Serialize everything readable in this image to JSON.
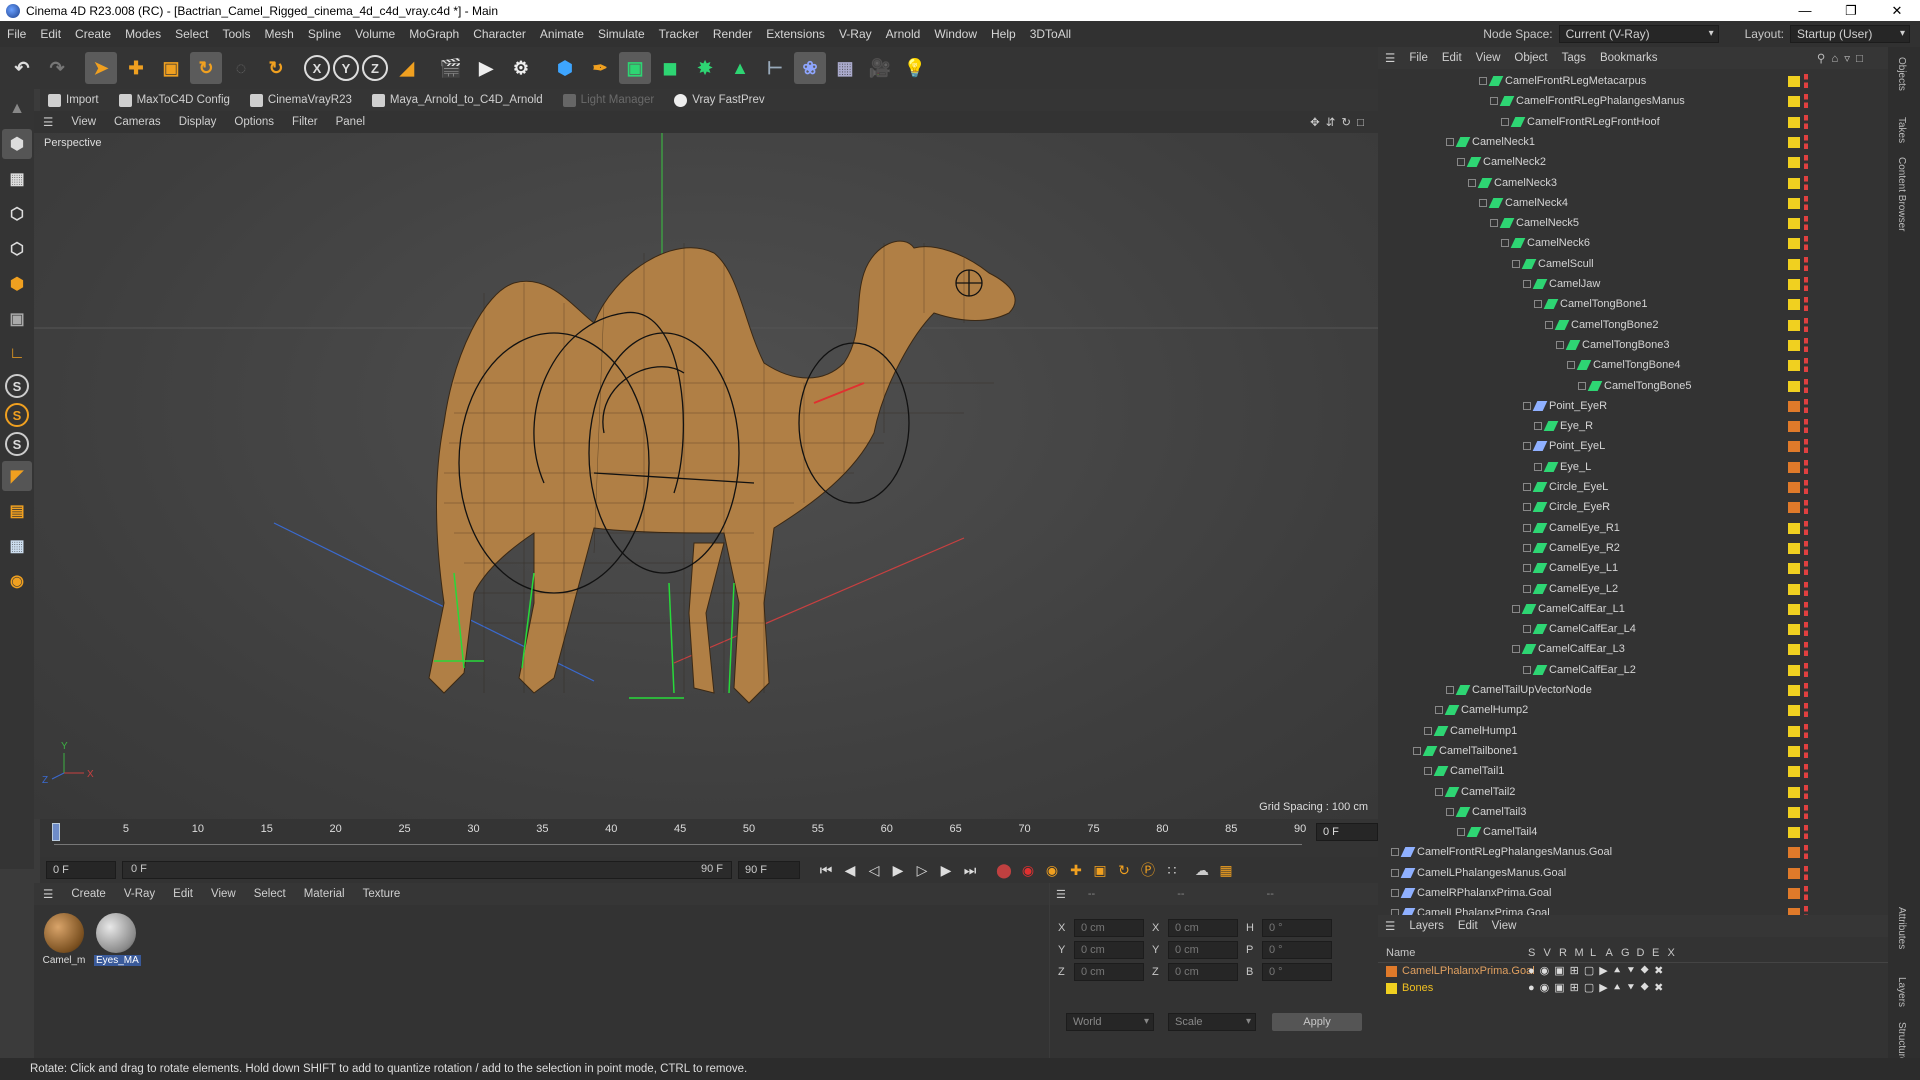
{
  "window": {
    "title": "Cinema 4D R23.008 (RC) - [Bactrian_Camel_Rigged_cinema_4d_c4d_vray.c4d *] - Main"
  },
  "menu": {
    "items": [
      "File",
      "Edit",
      "Create",
      "Modes",
      "Select",
      "Tools",
      "Mesh",
      "Spline",
      "Volume",
      "MoGraph",
      "Character",
      "Animate",
      "Simulate",
      "Tracker",
      "Render",
      "Extensions",
      "V-Ray",
      "Arnold",
      "Window",
      "Help",
      "3DToAll"
    ],
    "node_space_label": "Node Space:",
    "node_space_value": "Current (V-Ray)",
    "layout_label": "Layout:",
    "layout_value": "Startup (User)"
  },
  "plugins": [
    "Import",
    "MaxToC4D Config",
    "CinemaVrayR23",
    "Maya_Arnold_to_C4D_Arnold",
    "Light Manager",
    "Vray FastPrev"
  ],
  "viewport": {
    "menu": [
      "View",
      "Cameras",
      "Display",
      "Options",
      "Filter",
      "Panel"
    ],
    "label": "Perspective",
    "grid_spacing": "Grid Spacing : 100 cm"
  },
  "timeline": {
    "ticks": [
      "0",
      "5",
      "10",
      "15",
      "20",
      "25",
      "30",
      "35",
      "40",
      "45",
      "50",
      "55",
      "60",
      "65",
      "70",
      "75",
      "80",
      "85",
      "90"
    ],
    "current_frame": "0 F"
  },
  "transport": {
    "start": "0 F",
    "slider_start": "0 F",
    "slider_end": "90 F",
    "end": "90 F"
  },
  "material_menu": [
    "Create",
    "V-Ray",
    "Edit",
    "View",
    "Select",
    "Material",
    "Texture"
  ],
  "materials": [
    {
      "name": "Camel_m"
    },
    {
      "name": "Eyes_MA"
    }
  ],
  "coords": {
    "header": "--",
    "rows": [
      {
        "a": "X",
        "av": "0 cm",
        "b": "X",
        "bv": "0 cm",
        "c": "H",
        "cv": "0 °"
      },
      {
        "a": "Y",
        "av": "0 cm",
        "b": "Y",
        "bv": "0 cm",
        "c": "P",
        "cv": "0 °"
      },
      {
        "a": "Z",
        "av": "0 cm",
        "b": "Z",
        "bv": "0 cm",
        "c": "B",
        "cv": "0 °"
      }
    ],
    "mode1": "World",
    "mode2": "Scale",
    "apply": "Apply"
  },
  "objects": {
    "menu": [
      "File",
      "Edit",
      "View",
      "Object",
      "Tags",
      "Bookmarks"
    ],
    "rows": [
      {
        "name": "CamelFrontRLegMetacarpus",
        "d": 9
      },
      {
        "name": "CamelFrontRLegPhalangesManus",
        "d": 10
      },
      {
        "name": "CamelFrontRLegFrontHoof",
        "d": 11
      },
      {
        "name": "CamelNeck1",
        "d": 6
      },
      {
        "name": "CamelNeck2",
        "d": 7
      },
      {
        "name": "CamelNeck3",
        "d": 8
      },
      {
        "name": "CamelNeck4",
        "d": 9
      },
      {
        "name": "CamelNeck5",
        "d": 10
      },
      {
        "name": "CamelNeck6",
        "d": 11
      },
      {
        "name": "CamelScull",
        "d": 12
      },
      {
        "name": "CamelJaw",
        "d": 13
      },
      {
        "name": "CamelTongBone1",
        "d": 14
      },
      {
        "name": "CamelTongBone2",
        "d": 15
      },
      {
        "name": "CamelTongBone3",
        "d": 16
      },
      {
        "name": "CamelTongBone4",
        "d": 17
      },
      {
        "name": "CamelTongBone5",
        "d": 18
      },
      {
        "name": "Point_EyeR",
        "d": 13
      },
      {
        "name": "Eye_R",
        "d": 14
      },
      {
        "name": "Point_EyeL",
        "d": 13
      },
      {
        "name": "Eye_L",
        "d": 14
      },
      {
        "name": "Circle_EyeL",
        "d": 13
      },
      {
        "name": "Circle_EyeR",
        "d": 13
      },
      {
        "name": "CamelEye_R1",
        "d": 13
      },
      {
        "name": "CamelEye_R2",
        "d": 13
      },
      {
        "name": "CamelEye_L1",
        "d": 13
      },
      {
        "name": "CamelEye_L2",
        "d": 13
      },
      {
        "name": "CamelCalfEar_L1",
        "d": 12
      },
      {
        "name": "CamelCalfEar_L4",
        "d": 13
      },
      {
        "name": "CamelCalfEar_L3",
        "d": 12
      },
      {
        "name": "CamelCalfEar_L2",
        "d": 13
      },
      {
        "name": "CamelTailUpVectorNode",
        "d": 6
      },
      {
        "name": "CamelHump2",
        "d": 5
      },
      {
        "name": "CamelHump1",
        "d": 4
      },
      {
        "name": "CamelTailbone1",
        "d": 3
      },
      {
        "name": "CamelTail1",
        "d": 4
      },
      {
        "name": "CamelTail2",
        "d": 5
      },
      {
        "name": "CamelTail3",
        "d": 6
      },
      {
        "name": "CamelTail4",
        "d": 7
      },
      {
        "name": "CamelFrontRLegPhalangesManus.Goal",
        "d": 1
      },
      {
        "name": "CamelLPhalangesManus.Goal",
        "d": 1
      },
      {
        "name": "CamelRPhalanxPrima.Goal",
        "d": 1
      },
      {
        "name": "CamelLPhalanxPrima.Goal",
        "d": 1
      }
    ]
  },
  "layers": {
    "menu": [
      "Layers",
      "Edit",
      "View"
    ],
    "header": "Name",
    "cols": [
      "S",
      "V",
      "R",
      "M",
      "L",
      "A",
      "G",
      "D",
      "E",
      "X"
    ],
    "rows": [
      {
        "name": "CamelLPhalanxPrima.Goal"
      },
      {
        "name": "Bones"
      }
    ]
  },
  "right_tabs": [
    "Objects",
    "Takes",
    "Content Browser",
    "Attributes",
    "Layers",
    "Structure"
  ],
  "status": "Rotate: Click and drag to rotate elements. Hold down SHIFT to add to quantize rotation / add to the selection in point mode, CTRL to remove."
}
